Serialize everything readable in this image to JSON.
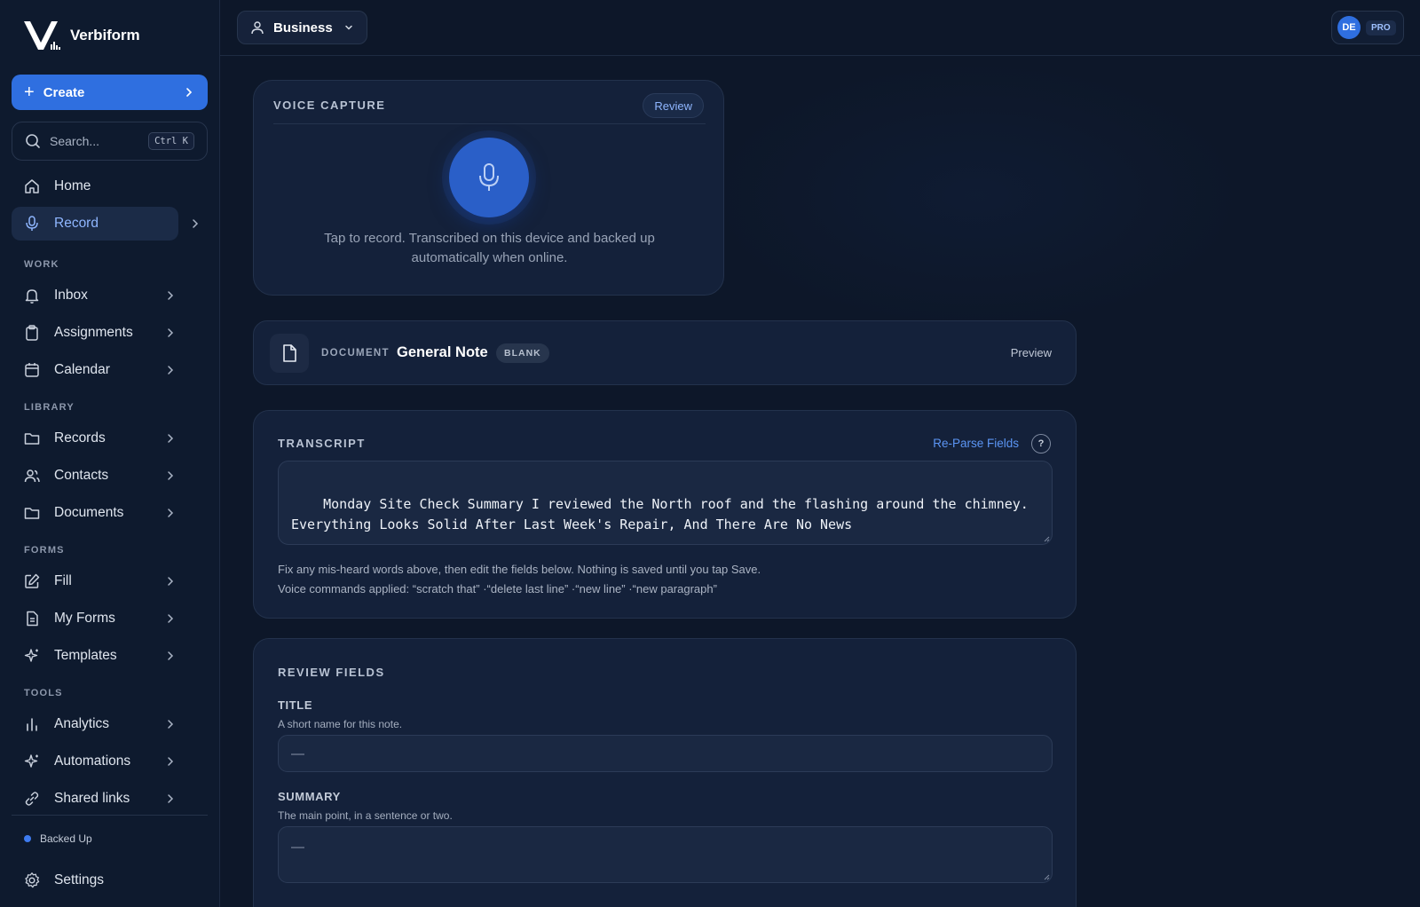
{
  "app": {
    "name": "Verbiform"
  },
  "sidebar": {
    "create_label": "Create",
    "search": {
      "placeholder": "Search...",
      "shortcut": "Ctrl K"
    },
    "primary": [
      {
        "label": "Home",
        "icon": "home-icon"
      },
      {
        "label": "Record",
        "icon": "mic-icon",
        "active": true
      }
    ],
    "sections": [
      {
        "title": "WORK",
        "items": [
          {
            "label": "Inbox",
            "icon": "bell-icon"
          },
          {
            "label": "Assignments",
            "icon": "clipboard-icon"
          },
          {
            "label": "Calendar",
            "icon": "calendar-icon"
          }
        ]
      },
      {
        "title": "LIBRARY",
        "items": [
          {
            "label": "Records",
            "icon": "folder-icon"
          },
          {
            "label": "Contacts",
            "icon": "users-icon"
          },
          {
            "label": "Documents",
            "icon": "folder-icon"
          }
        ]
      },
      {
        "title": "FORMS",
        "items": [
          {
            "label": "Fill",
            "icon": "edit-icon"
          },
          {
            "label": "My Forms",
            "icon": "file-text-icon"
          },
          {
            "label": "Templates",
            "icon": "sparkle-icon"
          }
        ]
      },
      {
        "title": "TOOLS",
        "items": [
          {
            "label": "Analytics",
            "icon": "bar-chart-icon"
          },
          {
            "label": "Automations",
            "icon": "sparkle-icon"
          },
          {
            "label": "Shared links",
            "icon": "link-icon"
          }
        ]
      }
    ],
    "status": "Backed Up",
    "settings_label": "Settings"
  },
  "topbar": {
    "workspace": "Business",
    "avatar_initials": "DE",
    "plan_badge": "PRO"
  },
  "voice_capture": {
    "title": "VOICE CAPTURE",
    "review_label": "Review",
    "hint": "Tap to record. Transcribed on this device and backed up automatically when online."
  },
  "document": {
    "kicker": "DOCUMENT",
    "name": "General Note",
    "badge": "BLANK",
    "preview_label": "Preview"
  },
  "transcript": {
    "title": "TRANSCRIPT",
    "reparse_label": "Re-Parse Fields",
    "help_label": "?",
    "text": "Monday Site Check Summary I reviewed the North roof and the flashing around the chimney. Everything Looks Solid After Last Week's Repair, And There Are No News",
    "help_line1": "Fix any mis-heard words above, then edit the fields below. Nothing is saved until you tap Save.",
    "help_line2": "Voice commands applied: “scratch that” ·“delete last line” ·“new line” ·“new paragraph”"
  },
  "review_fields": {
    "title": "REVIEW FIELDS",
    "fields": [
      {
        "label": "TITLE",
        "hint": "A short name for this note.",
        "value": "—"
      },
      {
        "label": "SUMMARY",
        "hint": "The main point, in a sentence or two.",
        "value": "—"
      }
    ]
  },
  "colors": {
    "accent": "#2f6fe0",
    "link": "#5b95f4",
    "background": "#0d1729",
    "card": "#14213a"
  }
}
